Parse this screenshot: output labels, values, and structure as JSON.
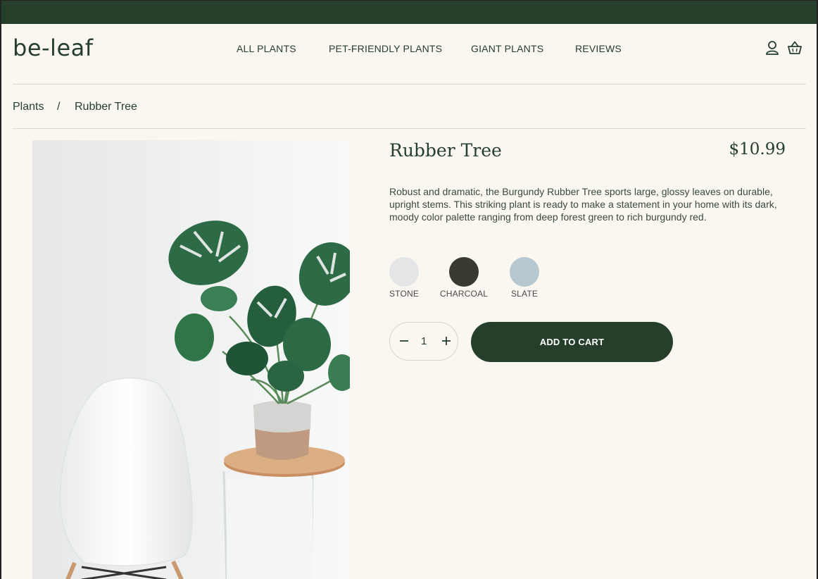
{
  "brand": {
    "logo_text": "be-leaf",
    "accent": "#253f2a",
    "background": "#faf7f1"
  },
  "nav": {
    "items": [
      "ALL PLANTS",
      "PET-FRIENDLY PLANTS",
      "GIANT PLANTS",
      "REVIEWS"
    ],
    "icons": [
      "user-icon",
      "basket-icon"
    ]
  },
  "breadcrumb": {
    "parent": "Plants",
    "separator": "/",
    "current": "Rubber Tree"
  },
  "product": {
    "title": "Rubber Tree",
    "price": "$10.99",
    "description": "Robust and dramatic, the Burgundy Rubber Tree sports large, glossy leaves on durable, upright stems. This striking plant is ready to make a statement in your home with its dark, moody color palette ranging from deep forest green to rich burgundy red.",
    "colors": [
      {
        "label": "STONE",
        "hex": "#e3e5e6"
      },
      {
        "label": "CHARCOAL",
        "hex": "#373a30"
      },
      {
        "label": "SLATE",
        "hex": "#b6c7d0"
      }
    ],
    "quantity": "1",
    "add_to_cart_label": "ADD TO CART"
  }
}
